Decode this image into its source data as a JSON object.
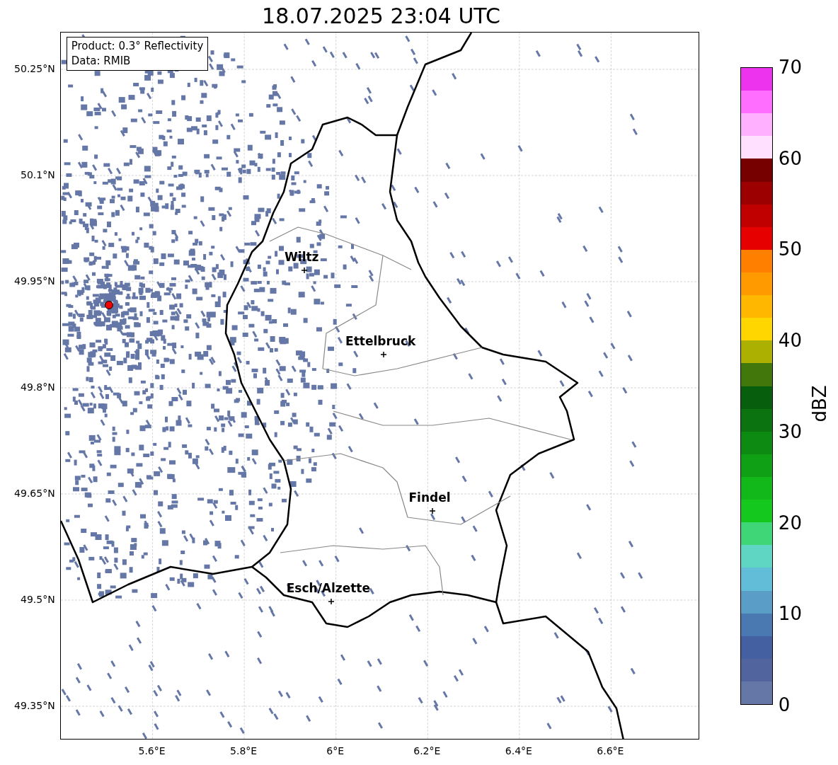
{
  "title": "18.07.2025 23:04 UTC",
  "legend": [
    "Product: 0.3° Reflectivity",
    "Data: RMIB"
  ],
  "map": {
    "lat_ticks": [
      "50.25°N",
      "50.1°N",
      "49.95°N",
      "49.8°N",
      "49.65°N",
      "49.5°N",
      "49.35°N"
    ],
    "lon_ticks": [
      "5.6°E",
      "5.8°E",
      "6°E",
      "6.2°E",
      "6.4°E",
      "6.6°E"
    ],
    "cities": [
      "Wiltz",
      "Ettelbruck",
      "Findel",
      "Esch/Alzette"
    ]
  },
  "colorbar": {
    "label": "dBZ",
    "ticks": [
      "70",
      "60",
      "50",
      "40",
      "30",
      "20",
      "10",
      "0"
    ],
    "bins": [
      {
        "color": "#ee33ee"
      },
      {
        "color": "#ff6eff"
      },
      {
        "color": "#ffb0ff"
      },
      {
        "color": "#ffe0ff"
      },
      {
        "color": "#760000"
      },
      {
        "color": "#9c0000"
      },
      {
        "color": "#c00000"
      },
      {
        "color": "#e60000"
      },
      {
        "color": "#ff7f00"
      },
      {
        "color": "#ff9a00"
      },
      {
        "color": "#ffb700"
      },
      {
        "color": "#ffd600"
      },
      {
        "color": "#acb000"
      },
      {
        "color": "#41770b"
      },
      {
        "color": "#075e0c"
      },
      {
        "color": "#0b7410"
      },
      {
        "color": "#0d8a12"
      },
      {
        "color": "#10a015"
      },
      {
        "color": "#12b81a"
      },
      {
        "color": "#15c81d"
      },
      {
        "color": "#3ed676"
      },
      {
        "color": "#5fd6c4"
      },
      {
        "color": "#62bdd8"
      },
      {
        "color": "#5a9ec8"
      },
      {
        "color": "#4a78b0"
      },
      {
        "color": "#4460a0"
      },
      {
        "color": "#52649d"
      },
      {
        "color": "#6577a6"
      }
    ]
  }
}
